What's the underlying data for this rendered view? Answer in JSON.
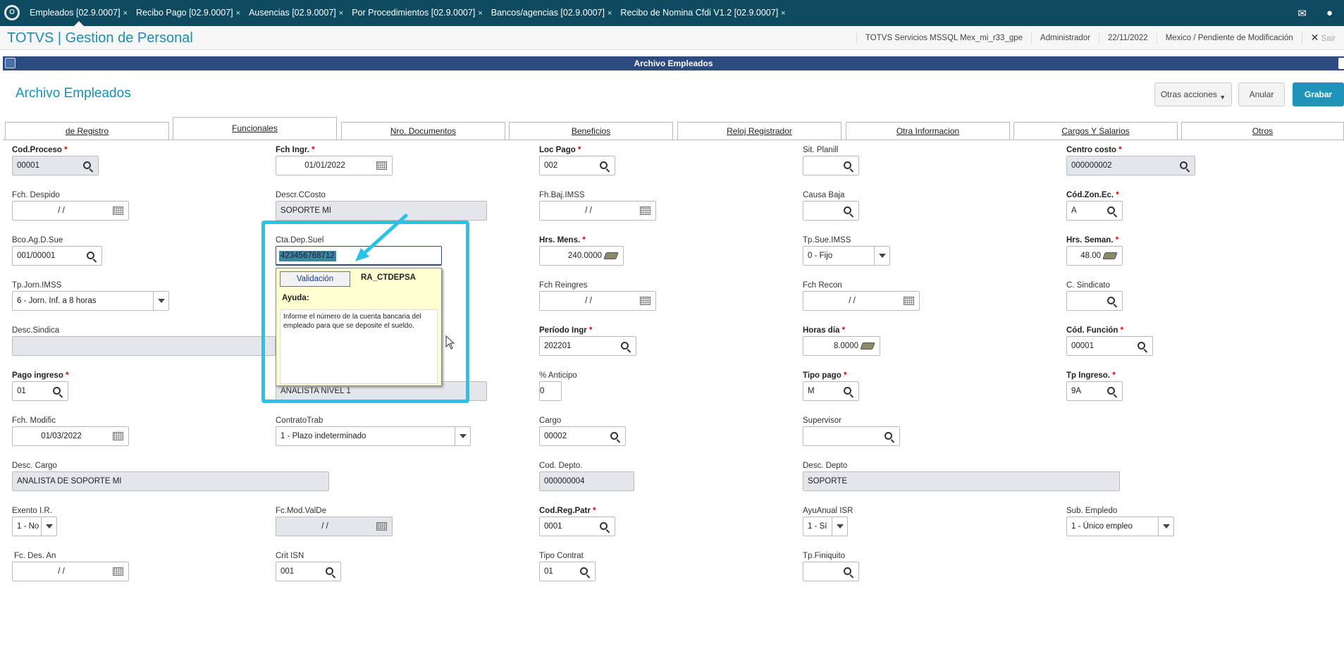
{
  "tabs": [
    {
      "label": "Empleados [02.9.0007]",
      "active": true
    },
    {
      "label": "Recibo Pago [02.9.0007]",
      "active": false
    },
    {
      "label": "Ausencias [02.9.0007]",
      "active": false
    },
    {
      "label": "Por Procedimientos [02.9.0007]",
      "active": false
    },
    {
      "label": "Bancos/agencias [02.9.0007]",
      "active": false
    },
    {
      "label": "Recibo de Nomina Cfdi V1.2 [02.9.0007]",
      "active": false
    }
  ],
  "close_glyph": "×",
  "header": {
    "title": "TOTVS | Gestion de Personal",
    "server": "TOTVS Servicios MSSQL Mex_mi_r33_gpe",
    "user": "Administrador",
    "date": "22/11/2022",
    "status": "Mexico / Pendiente de Modificación",
    "exit_label": "Sair"
  },
  "window": {
    "title": "Archivo Empleados"
  },
  "page": {
    "title": "Archivo Empleados"
  },
  "actions": {
    "otras": "Otras acciones",
    "anular": "Anular",
    "grabar": "Grabar"
  },
  "folder_tabs": [
    {
      "label": "de Registro",
      "active": false
    },
    {
      "label": "Funcionales",
      "active": true
    },
    {
      "label": "Nro. Documentos",
      "active": false
    },
    {
      "label": "Beneficios",
      "active": false
    },
    {
      "label": "Reloj Registrador",
      "active": false
    },
    {
      "label": "Otra Informacion",
      "active": false
    },
    {
      "label": "Cargos Y Salarios",
      "active": false
    },
    {
      "label": "Otros",
      "active": false
    }
  ],
  "fields": {
    "cod_proceso": {
      "label": "Cod.Proceso",
      "value": "00001"
    },
    "fch_ingr": {
      "label": "Fch Ingr.",
      "value": "01/01/2022"
    },
    "loc_pago": {
      "label": "Loc Pago",
      "value": "002"
    },
    "sit_planill": {
      "label": "Sit. Planill",
      "value": ""
    },
    "centro_costo": {
      "label": "Centro costo",
      "value": "000000002"
    },
    "fch_despido": {
      "label": "Fch. Despido",
      "value": "/ /"
    },
    "descr_ccosto": {
      "label": "Descr.CCosto",
      "value": "SOPORTE MI"
    },
    "fh_baj_imss": {
      "label": "Fh.Baj.IMSS",
      "value": "/ /"
    },
    "causa_baja": {
      "label": "Causa Baja",
      "value": ""
    },
    "cod_zon_ec": {
      "label": "Cód.Zon.Ec.",
      "value": "A"
    },
    "bco_ag_d_sue": {
      "label": "Bco.Ag.D.Sue",
      "value": "001/00001"
    },
    "cta_dep_suel": {
      "label": "Cta.Dep.Suel",
      "value": "423456768712"
    },
    "hrs_mens": {
      "label": "Hrs. Mens.",
      "value": "240.0000"
    },
    "tp_sue_imss": {
      "label": "Tp.Sue.IMSS",
      "value": "0 -  Fijo"
    },
    "hrs_seman": {
      "label": "Hrs. Seman.",
      "value": "48.00"
    },
    "tp_jorn_imss": {
      "label": "Tp.Jorn.IMSS",
      "value": "6 - Jorn. Inf. a 8 horas"
    },
    "fch_reingres": {
      "label": "Fch Reingres",
      "value": "/ /"
    },
    "fch_recon": {
      "label": "Fch Recon",
      "value": "/ /"
    },
    "c_sindicato": {
      "label": "C. Sindicato",
      "value": ""
    },
    "desc_sindica": {
      "label": "Desc.Sindica",
      "value": ""
    },
    "periodo_ingr": {
      "label": "Período Ingr",
      "value": "202201"
    },
    "horas_dia": {
      "label": "Horas día",
      "value": "8.0000"
    },
    "cod_funcion": {
      "label": "Cód. Función",
      "value": "00001"
    },
    "pago_ingreso": {
      "label": "Pago ingreso",
      "value": "01"
    },
    "desc_funcion": {
      "value": "ANALISTA NIVEL 1"
    },
    "pct_anticipo": {
      "label": "% Anticipo",
      "value": "0"
    },
    "tipo_pago": {
      "label": "Tipo pago",
      "value": "M"
    },
    "tp_ingreso": {
      "label": "Tp Ingreso.",
      "value": "9A"
    },
    "fch_modific": {
      "label": "Fch. Modific",
      "value": "01/03/2022"
    },
    "contrato_trab": {
      "label": "ContratoTrab",
      "value": "1 - Plazo indeterminado"
    },
    "cargo": {
      "label": "Cargo",
      "value": "00002"
    },
    "supervisor": {
      "label": "Supervisor",
      "value": ""
    },
    "desc_cargo": {
      "label": "Desc. Cargo",
      "value": "ANALISTA DE SOPORTE MI"
    },
    "cod_depto": {
      "label": "Cod. Depto.",
      "value": "000000004"
    },
    "desc_depto": {
      "label": "Desc. Depto",
      "value": "SOPORTE"
    },
    "exento_ir": {
      "label": "Exento I.R.",
      "value": "1 - No"
    },
    "fc_mod_valde": {
      "label": "Fc.Mod.ValDe",
      "value": "/ /"
    },
    "cod_reg_patr": {
      "label": "Cod.Reg.Patr",
      "value": "0001"
    },
    "ayuanual_isr": {
      "label": "AyuAnual ISR",
      "value": "1 - Sí"
    },
    "sub_empledo": {
      "label": "Sub. Empledo",
      "value": "1 - Único empleo"
    },
    "fc_des_an": {
      "label": "Fc. Des. An",
      "value": "/ /"
    },
    "crit_isn": {
      "label": "Crit ISN",
      "value": "001"
    },
    "tipo_contrat": {
      "label": "Tipo Contrat",
      "value": "01"
    },
    "tp_finiquito": {
      "label": "Tp.Finiquito",
      "value": ""
    }
  },
  "help": {
    "button": "Validación",
    "field_name": "RA_CTDEPSA",
    "title": "Ayuda:",
    "text": "Informe el número de la cuenta bancaria del empleado para que se deposite el sueldo."
  },
  "colors": {
    "highlight": "#29c3e6",
    "brand": "#1a8fb4",
    "topbar": "#0e4a60"
  }
}
